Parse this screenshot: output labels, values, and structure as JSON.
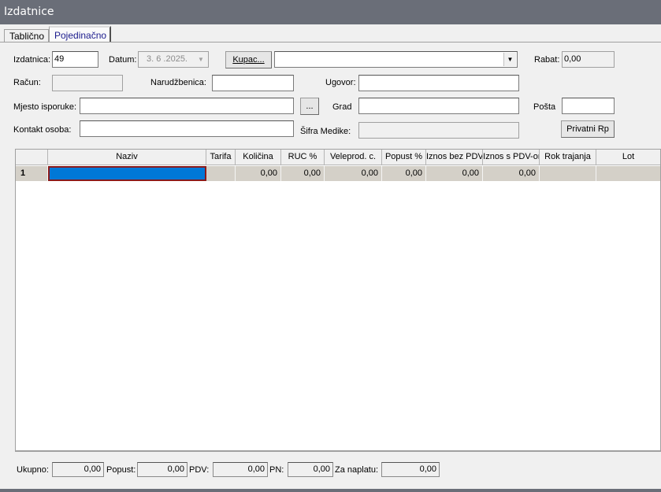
{
  "window": {
    "title": "Izdatnice"
  },
  "tabs": [
    {
      "label": "Tablično"
    },
    {
      "label": "Pojedinačno"
    }
  ],
  "form": {
    "izdatnica": {
      "label": "Izdatnica:",
      "value": "49"
    },
    "datum": {
      "label": "Datum:",
      "value": "3. 6 .2025."
    },
    "kupac": {
      "button_label": "Kupac...",
      "value": ""
    },
    "rabat": {
      "label": "Rabat:",
      "value": "0,00"
    },
    "racun": {
      "label": "Račun:",
      "value": ""
    },
    "narudzbenica": {
      "label": "Narudžbenica:",
      "value": ""
    },
    "ugovor": {
      "label": "Ugovor:",
      "value": ""
    },
    "mjesto_isporuke": {
      "label": "Mjesto isporuke:",
      "value": "",
      "browse_label": "..."
    },
    "grad": {
      "label": "Grad",
      "value": ""
    },
    "posta": {
      "label": "Pošta",
      "value": ""
    },
    "kontakt_osoba": {
      "label": "Kontakt osoba:",
      "value": ""
    },
    "sifra_medike": {
      "label": "Šifra Medike:",
      "value": ""
    },
    "privatni_rp": {
      "button_label": "Privatni Rp"
    }
  },
  "grid": {
    "columns": [
      "",
      "Naziv",
      "Tarifa",
      "Količina",
      "RUC %",
      "Veleprod. c.",
      "Popust %",
      "Iznos bez PDV",
      "Iznos s PDV-om",
      "Rok trajanja",
      "Lot"
    ],
    "rows": [
      {
        "num": "1",
        "naziv": "",
        "tarifa": "",
        "kolicina": "0,00",
        "ruc": "0,00",
        "veleprod": "0,00",
        "popust": "0,00",
        "iznos_bez": "0,00",
        "iznos_s": "0,00",
        "rok": "",
        "lot": ""
      }
    ]
  },
  "totals": {
    "ukupno": {
      "label": "Ukupno:",
      "value": "0,00"
    },
    "popust": {
      "label": "Popust:",
      "value": "0,00"
    },
    "pdv": {
      "label": "PDV:",
      "value": "0,00"
    },
    "pn": {
      "label": "PN:",
      "value": "0,00"
    },
    "za_naplatu": {
      "label": "Za naplatu:",
      "value": "0,00"
    }
  },
  "colors": {
    "titlebar": "#6a6e78",
    "selection": "#0078d7",
    "cell_bg": "#d4d0c8",
    "tab_active_text": "#1a1a8c"
  }
}
